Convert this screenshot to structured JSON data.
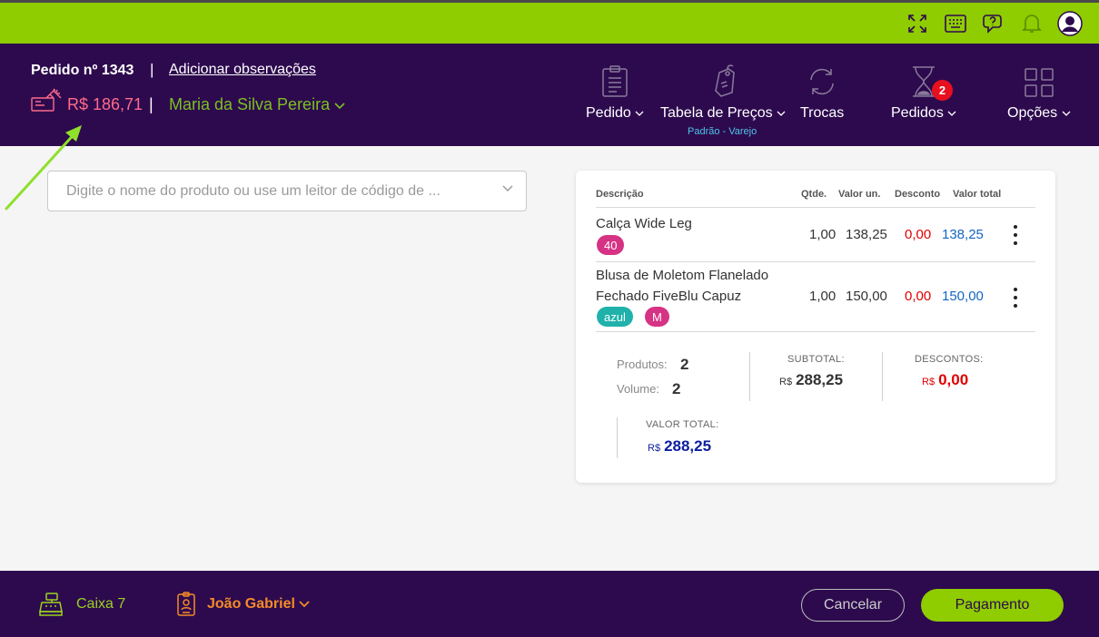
{
  "topbar": {
    "icons": [
      "fullscreen-icon",
      "keyboard-icon",
      "help-icon",
      "bell-icon",
      "user-avatar-icon"
    ]
  },
  "header": {
    "order_label": "Pedido nº 1343",
    "separator": "|",
    "add_observations": "Adicionar observações",
    "amount": "R$ 186,71",
    "customer": "Maria da Silva Pereira",
    "nav": [
      {
        "label": "Pedido",
        "icon": "clipboard-icon"
      },
      {
        "label": "Tabela de Preços",
        "icon": "price-tag-icon",
        "sub": "Padrão - Varejo"
      },
      {
        "label": "Trocas",
        "icon": "exchange-icon"
      },
      {
        "label": "Pedidos",
        "icon": "hourglass-icon",
        "badge": "2"
      },
      {
        "label": "Opções",
        "icon": "grid-icon"
      }
    ]
  },
  "search": {
    "placeholder": "Digite o nome do produto ou use um leitor de código de ..."
  },
  "cart": {
    "columns": [
      "Descrição",
      "Qtde.",
      "Valor un.",
      "Desconto",
      "Valor total"
    ],
    "items": [
      {
        "name_lines": [
          "Calça Wide Leg"
        ],
        "tags": [
          "40"
        ],
        "qty": "1,00",
        "unit": "138,25",
        "discount": "0,00",
        "total": "138,25"
      },
      {
        "name_lines": [
          "Blusa de Moletom Flanelado",
          "Fechado FiveBlu Capuz"
        ],
        "tags": [
          "azul",
          "M"
        ],
        "qty": "1,00",
        "unit": "150,00",
        "discount": "0,00",
        "total": "150,00"
      }
    ],
    "summary": {
      "products_label": "Produtos:",
      "products_value": "2",
      "volume_label": "Volume:",
      "volume_value": "2",
      "subtotal_label": "SUBTOTAL:",
      "subtotal_currency": "R$",
      "subtotal_value": "288,25",
      "discounts_label": "DESCONTOS:",
      "discounts_currency": "R$",
      "discounts_value": "0,00",
      "total_label": "VALOR TOTAL:",
      "total_currency": "R$",
      "total_value": "288,25"
    }
  },
  "footer": {
    "register": "Caixa 7",
    "operator": "João Gabriel",
    "cancel_label": "Cancelar",
    "pay_label": "Pagamento"
  },
  "colors": {
    "brand_green": "#8fcc00",
    "brand_purple": "#2d0a4e",
    "amount_pink": "#ff6b8a",
    "customer_green": "#7ac11f",
    "badge_red": "#e8101e",
    "tag_pink": "#d63384",
    "tag_teal": "#20b2aa",
    "discount_red": "#e00000",
    "total_blue": "#1565c0",
    "grand_total_navy": "#0d1f9e",
    "operator_orange": "#f58b26"
  }
}
